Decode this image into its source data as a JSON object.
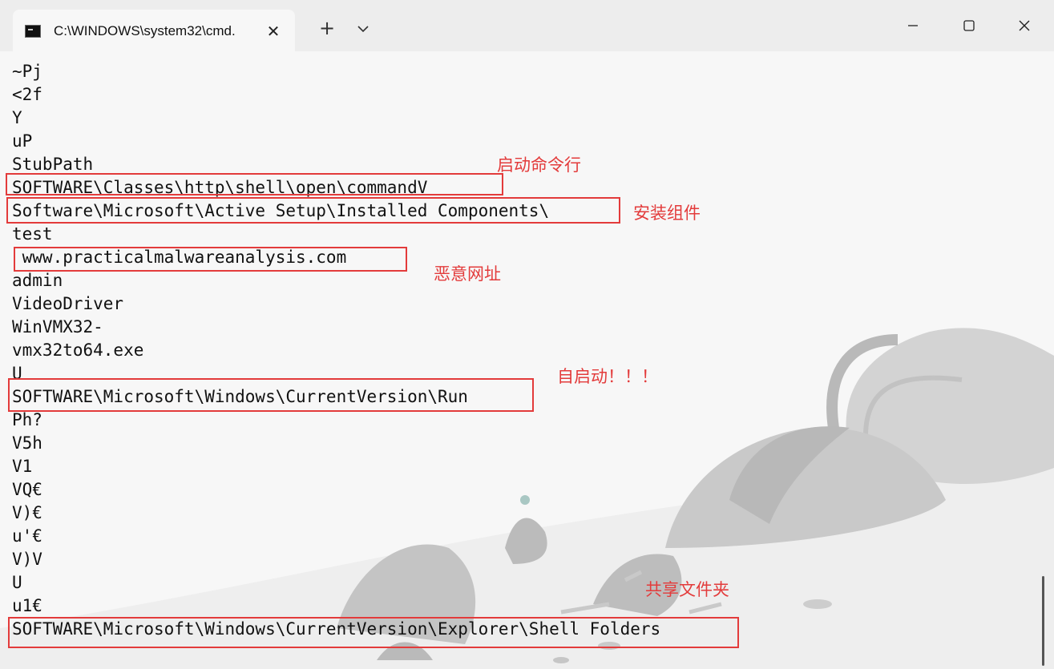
{
  "window": {
    "tab_title": "C:\\WINDOWS\\system32\\cmd.",
    "new_tab_label": "+",
    "close_tab_label": "✕"
  },
  "terminal": {
    "lines": [
      "~Pj",
      "<2f",
      "Y",
      "uP",
      "StubPath",
      "SOFTWARE\\Classes\\http\\shell\\open\\commandV",
      "Software\\Microsoft\\Active Setup\\Installed Components\\",
      "test",
      " www.practicalmalwareanalysis.com",
      "admin",
      "VideoDriver",
      "WinVMX32-",
      "vmx32to64.exe",
      "U",
      "SOFTWARE\\Microsoft\\Windows\\CurrentVersion\\Run",
      "Ph?",
      "V5h",
      "V1",
      "VQ€",
      "V)€",
      "u'€",
      "V)V",
      "U",
      "u1€",
      "SOFTWARE\\Microsoft\\Windows\\CurrentVersion\\Explorer\\Shell Folders"
    ]
  },
  "annotations": [
    {
      "label": "启动命令行"
    },
    {
      "label": "安装组件"
    },
    {
      "label": "恶意网址"
    },
    {
      "label": "自启动！！！"
    },
    {
      "label": "共享文件夹"
    }
  ],
  "colors": {
    "annotation": "#e33b3b",
    "text": "#111111",
    "background": "#f7f7f7"
  },
  "icons": {
    "tab": "terminal-icon",
    "close_tab": "close-icon",
    "new_tab": "plus-icon",
    "dropdown": "chevron-down-icon",
    "minimize": "minimize-icon",
    "maximize": "maximize-icon",
    "close_window": "close-icon"
  }
}
